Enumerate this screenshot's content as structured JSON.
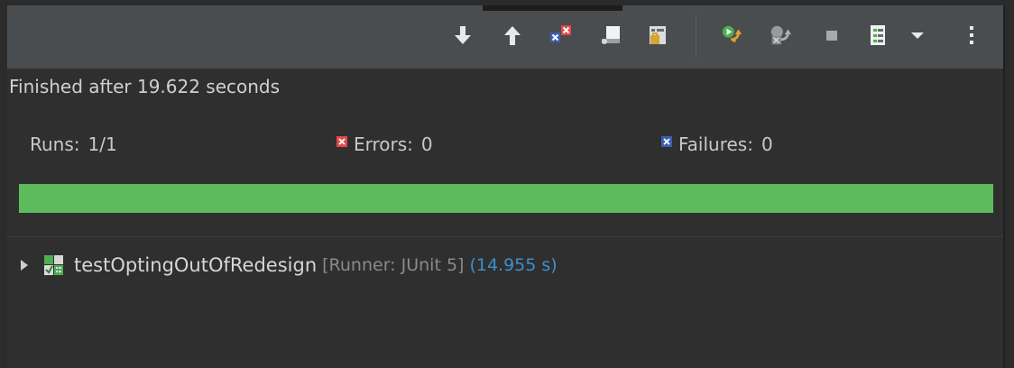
{
  "toolbar": {
    "buttons": [
      {
        "name": "next-failure-icon"
      },
      {
        "name": "previous-failure-icon"
      },
      {
        "name": "show-failures-only-icon"
      },
      {
        "name": "scroll-lock-icon"
      },
      {
        "name": "show-skipped-only-icon"
      },
      {
        "name": "rerun-test-icon"
      },
      {
        "name": "rerun-failed-first-icon"
      },
      {
        "name": "stop-icon"
      },
      {
        "name": "test-run-history-icon"
      },
      {
        "name": "chevron-down-icon"
      },
      {
        "name": "view-menu-icon"
      }
    ]
  },
  "status": {
    "text": "Finished after 19.622 seconds"
  },
  "stats": {
    "runs_label": "Runs:",
    "runs_value": "1/1",
    "errors_label": "Errors:",
    "errors_value": "0",
    "failures_label": "Failures:",
    "failures_value": "0"
  },
  "progress": {
    "fraction": 1.0,
    "color": "#5dbb5e"
  },
  "tree": {
    "items": [
      {
        "name": "testOptingOutOfRedesign",
        "runner": "[Runner: JUnit 5]",
        "time": "(14.955 s)"
      }
    ]
  },
  "colors": {
    "error": "#e04a4a",
    "failure": "#3b5fb0",
    "time": "#3d8fcf",
    "toolbar": "#4a4d50",
    "background": "#2f2f2f"
  }
}
